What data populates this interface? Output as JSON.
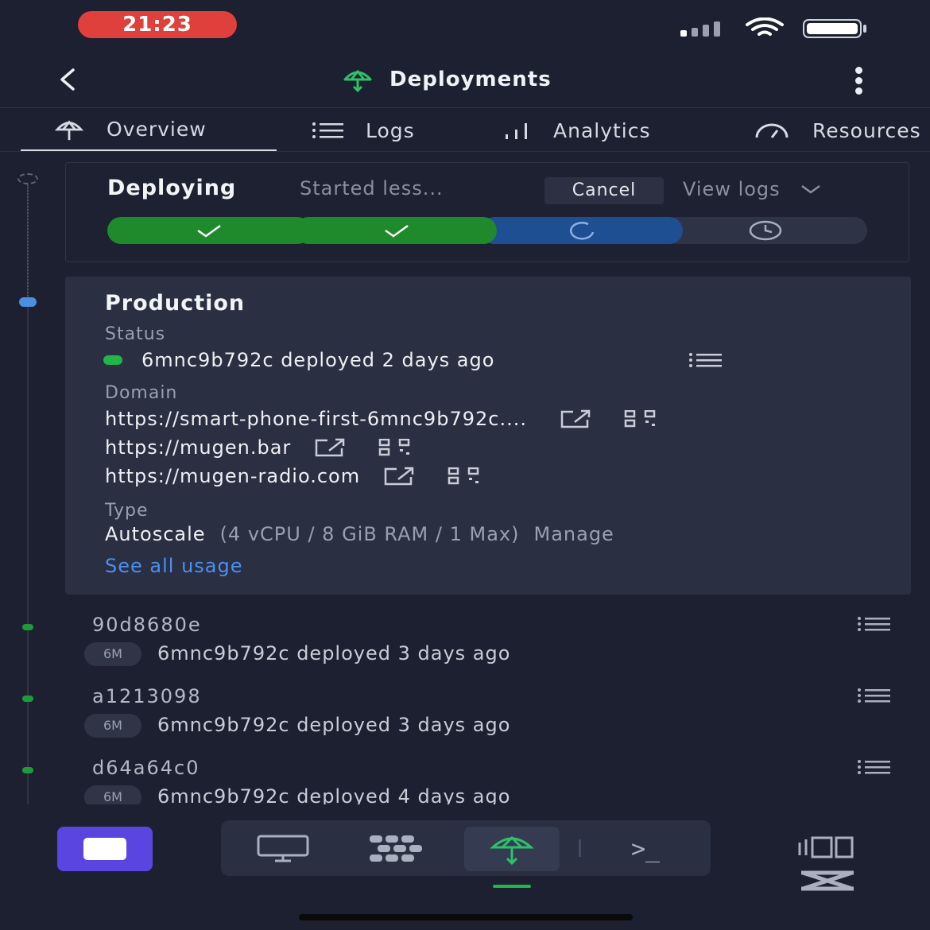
{
  "status_bar": {
    "time": "21:23"
  },
  "header": {
    "title": "Deployments"
  },
  "tabs": [
    {
      "label": "Overview"
    },
    {
      "label": "Logs"
    },
    {
      "label": "Analytics"
    },
    {
      "label": "Resources"
    }
  ],
  "deploying": {
    "title": "Deploying",
    "subtitle": "Started less...",
    "cancel_label": "Cancel",
    "view_logs_label": "View logs",
    "steps": [
      "complete",
      "complete",
      "in-progress",
      "pending"
    ]
  },
  "production": {
    "title": "Production",
    "status_label": "Status",
    "status_text": "6mnc9b792c deployed 2 days ago",
    "domain_label": "Domain",
    "domains": [
      "https://smart-phone-first-6mnc9b792c....",
      "https://mugen.bar",
      "https://mugen-radio.com"
    ],
    "type_label": "Type",
    "type_value": "Autoscale",
    "type_spec": "(4 vCPU / 8 GiB RAM / 1 Max)",
    "manage_label": "Manage",
    "usage_link": "See all usage"
  },
  "history": [
    {
      "hash": "90d8680e",
      "badge": "6M",
      "text": "6mnc9b792c deployed 3 days ago"
    },
    {
      "hash": "a1213098",
      "badge": "6M",
      "text": "6mnc9b792c deployed 3 days ago"
    },
    {
      "hash": "d64a64c0",
      "badge": "6M",
      "text": "6mnc9b792c deployed 4 days ago"
    }
  ],
  "bottom_nav": {
    "items": [
      "desktop-icon",
      "grid-icon",
      "deploy-icon",
      "terminal-icon"
    ],
    "terminal_label": ">_"
  },
  "colors": {
    "background": "#1c2030",
    "card": "#2a3042",
    "success": "#1f8a2c",
    "progress": "#1f4f93",
    "link": "#4b8ff0",
    "accent": "#5a45e0",
    "time_pill": "#e0403c"
  }
}
